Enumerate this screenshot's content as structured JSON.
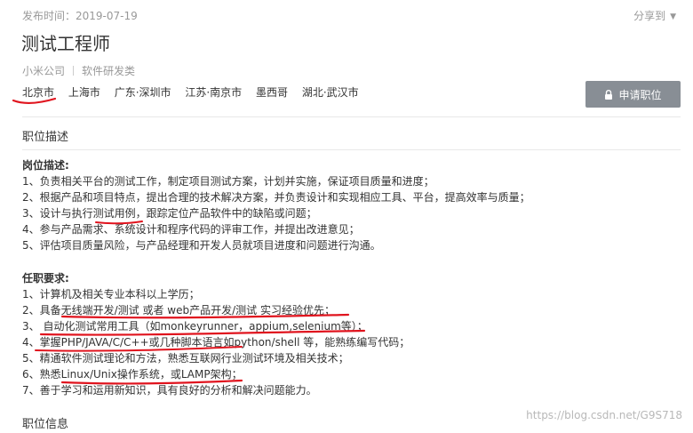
{
  "header": {
    "publish_date": "发布时间：2019-07-19",
    "share_label": "分享到",
    "title": "测试工程师",
    "company": "小米公司",
    "category": "软件研发类",
    "cities": [
      "北京市",
      "上海市",
      "广东·深圳市",
      "江苏·南京市",
      "墨西哥",
      "湖北·武汉市"
    ],
    "apply_label": "申请职位"
  },
  "sections": {
    "description_heading": "职位描述",
    "info_heading": "职位信息"
  },
  "duties": {
    "heading": "岗位描述:",
    "items": [
      "1、负责相关平台的测试工作，制定项目测试方案，计划并实施，保证项目质量和进度；",
      "2、根据产品和项目特点，提出合理的技术解决方案，并负责设计和实现相应工具、平台，提高效率与质量；",
      "3、设计与执行测试用例，跟踪定位产品软件中的缺陷或问题；",
      "4、参与产品需求、系统设计和程序代码的评审工作，并提出改进意见；",
      "5、评估项目质量风险，与产品经理和开发人员就项目进度和问题进行沟通。"
    ]
  },
  "requirements": {
    "heading": "任职要求:",
    "items": [
      "1、计算机及相关专业本科以上学历；",
      "2、具备无线端开发/测试 或者 web产品开发/测试 实习经验优先；",
      "3、 自动化测试常用工具（如monkeyrunner，appium,selenium等）；",
      "4、掌握PHP/JAVA/C/C++或几种脚本语言如python/shell 等，能熟练编写代码；",
      "5、精通软件测试理论和方法，熟悉互联网行业测试环境及相关技术；",
      "6、熟悉Linux/Unix操作系统，或LAMP架构；",
      "7、善于学习和运用新知识，具有良好的分析和解决问题能力。"
    ]
  },
  "watermark": "https://blog.csdn.net/G9S718",
  "colors": {
    "annotation_red": "#e0141e",
    "apply_button": "#888e95",
    "muted_text": "#999999"
  }
}
